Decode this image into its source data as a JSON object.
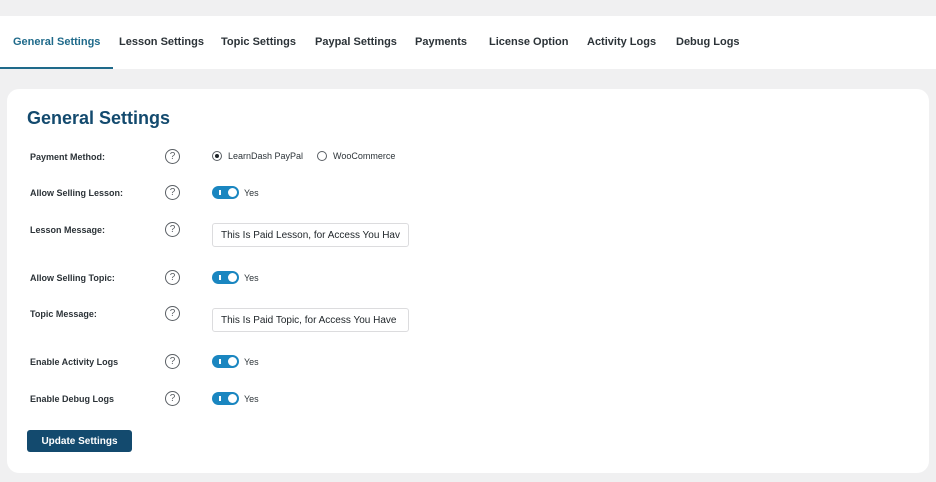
{
  "tabs": [
    {
      "label": "General Settings"
    },
    {
      "label": "Lesson Settings"
    },
    {
      "label": "Topic Settings"
    },
    {
      "label": "Paypal Settings"
    },
    {
      "label": "Payments"
    },
    {
      "label": "License Option"
    },
    {
      "label": "Activity Logs"
    },
    {
      "label": "Debug Logs"
    }
  ],
  "page": {
    "title": "General Settings"
  },
  "settings": {
    "payment_method": {
      "label": "Payment Method:",
      "options": [
        {
          "label": "LearnDash PayPal",
          "checked": true
        },
        {
          "label": "WooCommerce",
          "checked": false
        }
      ]
    },
    "allow_selling_lesson": {
      "label": "Allow Selling Lesson:",
      "state": "Yes"
    },
    "lesson_message": {
      "label": "Lesson Message:",
      "value": "This Is Paid Lesson, for Access You Hav"
    },
    "allow_selling_topic": {
      "label": "Allow Selling Topic:",
      "state": "Yes"
    },
    "topic_message": {
      "label": "Topic Message:",
      "value": "This Is Paid Topic, for Access You Have"
    },
    "enable_activity_logs": {
      "label": "Enable Activity Logs",
      "state": "Yes"
    },
    "enable_debug_logs": {
      "label": "Enable Debug Logs",
      "state": "Yes"
    }
  },
  "help_glyph": "?",
  "update_button": {
    "label": "Update Settings"
  },
  "colors": {
    "accent": "#1f6a8a",
    "toggle_on": "#1a86c0",
    "button": "#134a6e"
  }
}
